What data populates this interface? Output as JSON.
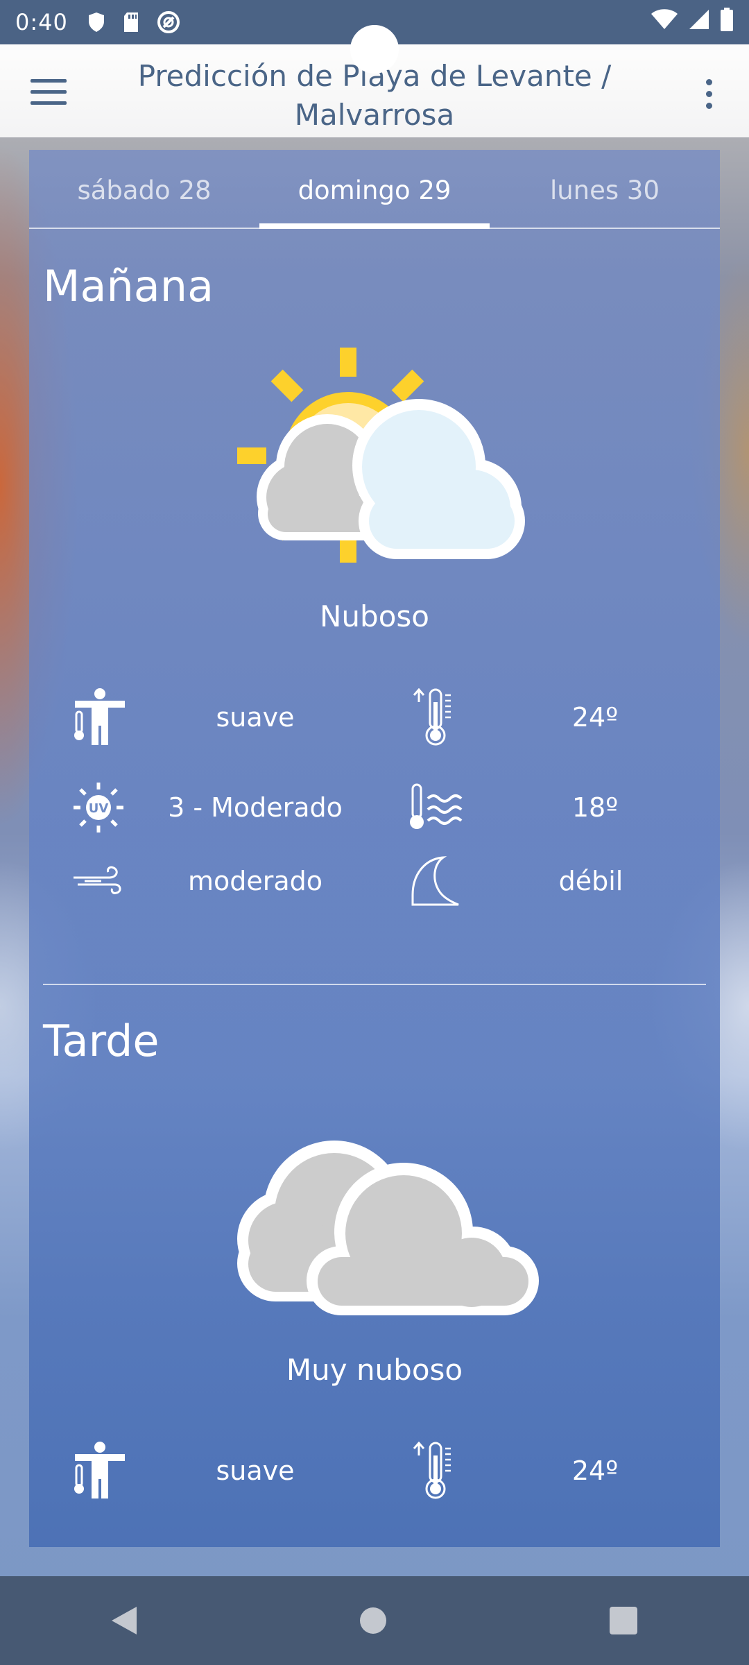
{
  "status_bar": {
    "time": "0:40",
    "left_icons": [
      "shield-icon",
      "sd-card-icon",
      "no-disturb-icon"
    ],
    "right_icons": [
      "wifi-icon",
      "signal-icon",
      "battery-icon"
    ]
  },
  "app_bar": {
    "title": "Predicción de Playa de Levante / Malvarrosa",
    "menu_icon": "hamburger-menu-icon",
    "overflow_icon": "more-vert-icon"
  },
  "tabs": [
    {
      "label": "sábado 28",
      "active": false
    },
    {
      "label": "domingo 29",
      "active": true
    },
    {
      "label": "lunes 30",
      "active": false
    }
  ],
  "morning": {
    "title": "Mañana",
    "icon": "sun-cloud-icon",
    "condition": "Nuboso",
    "sensation": "suave",
    "max_temp": "24º",
    "uv": "3 - Moderado",
    "water_temp": "18º",
    "wind": "moderado",
    "waves": "débil"
  },
  "afternoon": {
    "title": "Tarde",
    "icon": "clouds-icon",
    "condition": "Muy nuboso",
    "sensation": "suave",
    "max_temp": "24º"
  },
  "colors": {
    "status_bar": "#4b6385",
    "title_text": "#4a6587",
    "sun": "#fdd12c",
    "cloud_grey": "#c8c8c8",
    "cloud_light": "#e3f2fa",
    "nav_bar": "#475973"
  }
}
